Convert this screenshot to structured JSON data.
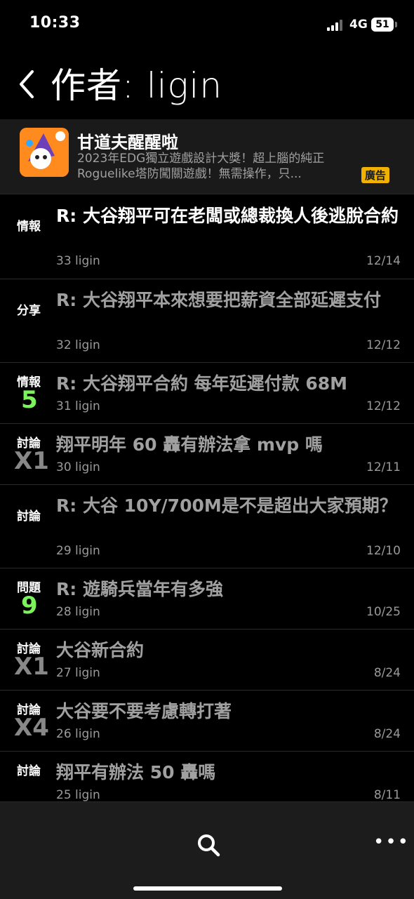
{
  "status": {
    "time": "10:33",
    "network": "4G",
    "battery": "51"
  },
  "nav": {
    "title": "作者: ligin"
  },
  "ad": {
    "title": "甘道夫醒醒啦",
    "desc": "2023年EDG獨立遊戲設計大獎！超上腦的純正Roguelike塔防闖關遊戲！無需操作，只...",
    "badge": "廣告",
    "icon_label": "TD"
  },
  "posts": [
    {
      "tag": "情報",
      "count": "",
      "title": "R: 大谷翔平可在老闆或總裁換人後逃脫合約",
      "meta": "33 ligin",
      "date": "12/14",
      "read": false
    },
    {
      "tag": "分享",
      "count": "",
      "title": "R: 大谷翔平本來想要把薪資全部延遲支付",
      "meta": "32 ligin",
      "date": "12/12",
      "read": true
    },
    {
      "tag": "情報",
      "count": "5",
      "count_color": "green",
      "title": "R: 大谷翔平合約 每年延遲付款 68M",
      "meta": "31 ligin",
      "date": "12/12",
      "read": true
    },
    {
      "tag": "討論",
      "count": "X1",
      "count_color": "gray",
      "title": "翔平明年 60 轟有辦法拿 mvp 嗎",
      "meta": "30 ligin",
      "date": "12/11",
      "read": true
    },
    {
      "tag": "討論",
      "count": "",
      "title": "R: 大谷 10Y/700M是不是超出大家預期？",
      "meta": "29 ligin",
      "date": "12/10",
      "read": true
    },
    {
      "tag": "問題",
      "count": "9",
      "count_color": "green",
      "title": "R: 遊騎兵當年有多強",
      "meta": "28 ligin",
      "date": "10/25",
      "read": true
    },
    {
      "tag": "討論",
      "count": "X1",
      "count_color": "gray",
      "title": "大谷新合約",
      "meta": "27 ligin",
      "date": "8/24",
      "read": true
    },
    {
      "tag": "討論",
      "count": "X4",
      "count_color": "gray",
      "title": "大谷要不要考慮轉打著",
      "meta": "26 ligin",
      "date": "8/24",
      "read": true
    },
    {
      "tag": "討論",
      "count": "",
      "title": "翔平有辦法 50 轟嗎",
      "meta": "25 ligin",
      "date": "8/11",
      "read": true
    }
  ],
  "bottom": {
    "more": "•••"
  },
  "colors": {
    "unread_title": "#ffffff",
    "read_title": "#a0a0a0",
    "recommend_green": "#7cf25c",
    "badge": "#f0b100"
  }
}
